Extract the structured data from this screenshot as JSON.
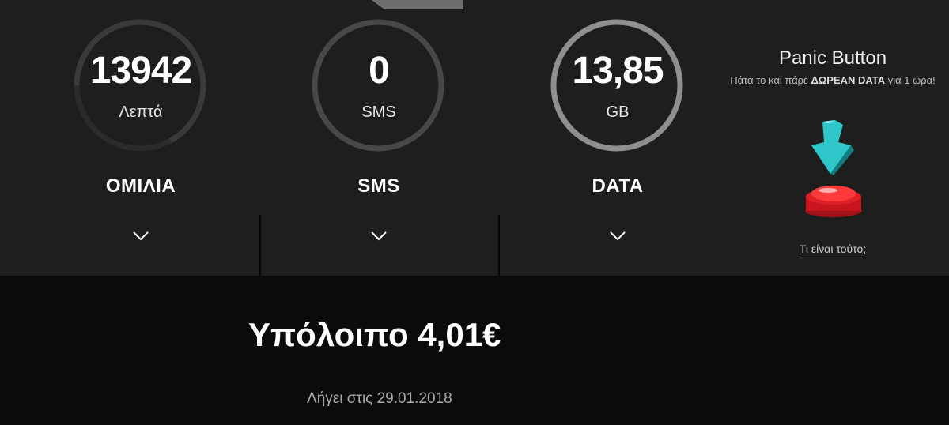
{
  "meters": [
    {
      "id": "voice",
      "value": "13942",
      "unit": "Λεπτά",
      "title": "ΟΜΙΛΙΑ",
      "fill": 0.67,
      "track_color": "#3a3a3a",
      "arc_color": "#3a3a3a"
    },
    {
      "id": "sms",
      "value": "0",
      "unit": "SMS",
      "title": "SMS",
      "fill": 1.0,
      "track_color": "#48484a",
      "arc_color": "#48484a"
    },
    {
      "id": "data",
      "value": "13,85",
      "unit": "GB",
      "title": "DATA",
      "fill": 1.0,
      "track_color": "#8f8f92",
      "arc_color": "#8f8f92"
    }
  ],
  "panic": {
    "title": "Panic Button",
    "sub_prefix": "Πάτα το και πάρε ",
    "sub_bold": "ΔΩΡΕΑΝ DATA",
    "sub_suffix": " για 1 ώρα!",
    "link": "Τι είναι τούτο;"
  },
  "balance": {
    "label": "Υπόλοιπο ",
    "amount": "4,01€",
    "accent": "#e8323c"
  },
  "expiry": "Λήγει στις 29.01.2018"
}
